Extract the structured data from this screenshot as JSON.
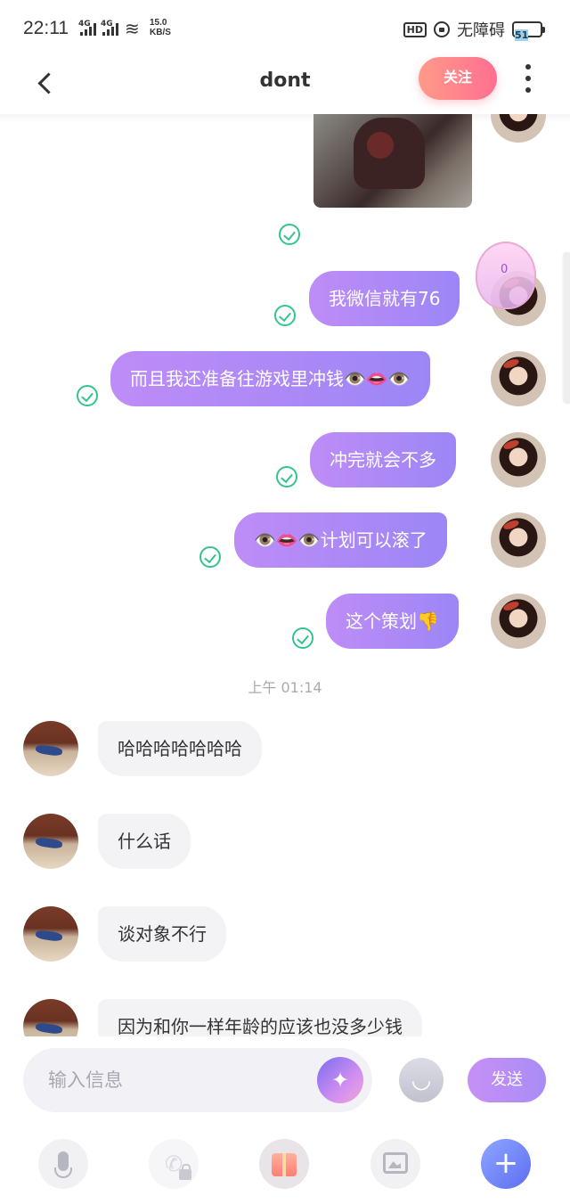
{
  "status_bar": {
    "time": "22:11",
    "net1": "4G",
    "net2": "4G",
    "speed_value": "15.0",
    "speed_unit": "KB/S",
    "hd": "HD",
    "accessibility": "无障碍",
    "battery": "51"
  },
  "header": {
    "title": "dont",
    "follow_label": "关注"
  },
  "messages_out": [
    {
      "text": "我微信就有76"
    },
    {
      "text": "而且我还准备往游戏里冲钱👁️👄👁️"
    },
    {
      "text": "冲完就会不多"
    },
    {
      "text": "👁️👄👁️计划可以滚了"
    },
    {
      "text": "这个策划👎"
    }
  ],
  "timestamp": "上午 01:14",
  "messages_in": [
    {
      "text": "哈哈哈哈哈哈哈"
    },
    {
      "text": "什么话"
    },
    {
      "text": "谈对象不行"
    },
    {
      "text": "因为和你一样年龄的应该也没多少钱"
    }
  ],
  "heart_badge_count": "0",
  "input": {
    "placeholder": "输入信息",
    "send_label": "发送"
  },
  "colors": {
    "bubble_out": "#b08af6",
    "bubble_in": "#f3f3f6",
    "check": "#33c48c",
    "follow": "#ff7f8c"
  }
}
